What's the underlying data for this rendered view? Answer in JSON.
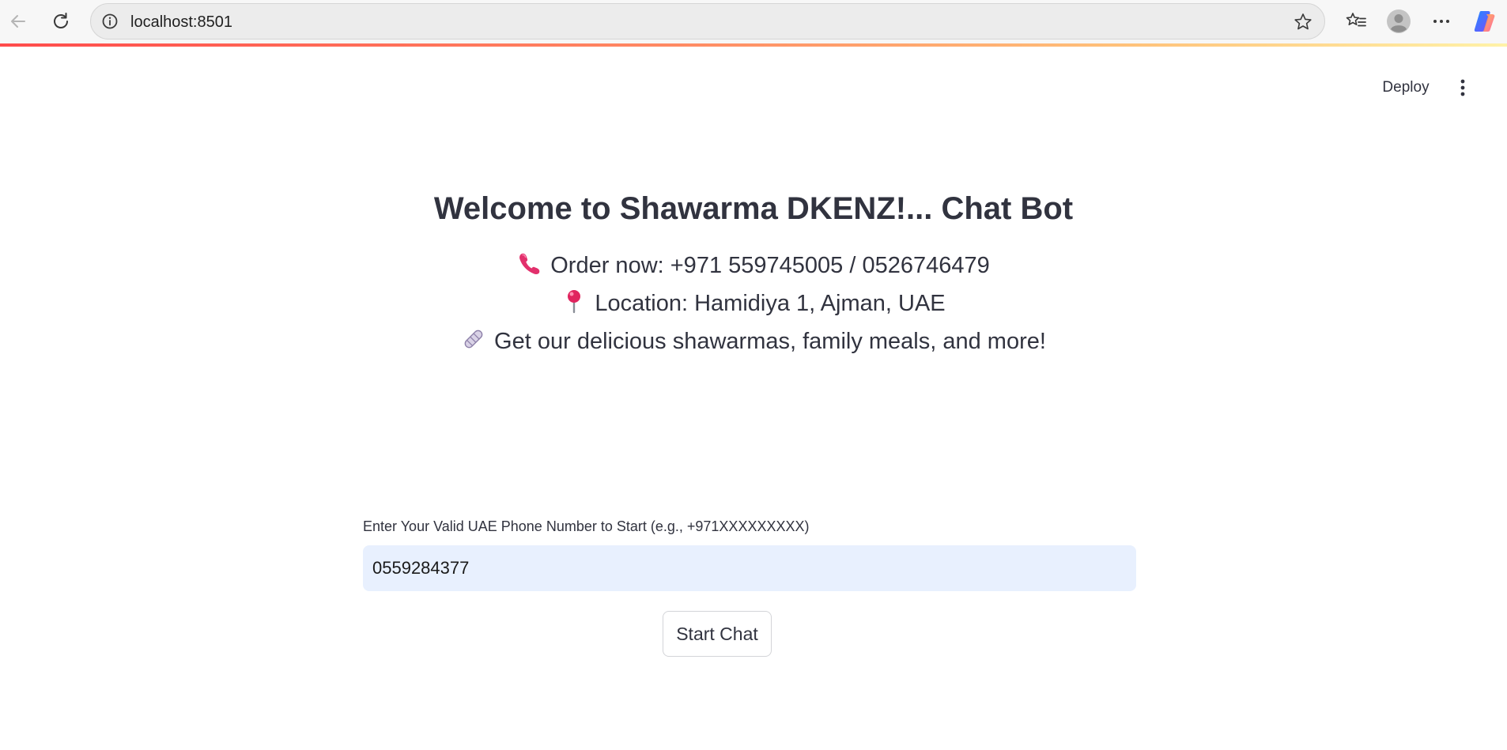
{
  "browser": {
    "url": "localhost:8501",
    "icons": [
      "back-icon",
      "reload-icon",
      "site-info-icon",
      "favorite-star-icon",
      "favorites-list-icon",
      "profile-avatar-icon",
      "more-options-icon",
      "copilot-icon"
    ]
  },
  "header": {
    "deploy_label": "Deploy",
    "menu_icon": "kebab-menu-icon"
  },
  "welcome": {
    "title": "Welcome to Shawarma DKENZ!... Chat Bot",
    "lines": [
      {
        "icon": "telephone-icon",
        "text": "Order now: +971 559745005 / 0526746479"
      },
      {
        "icon": "pushpin-icon",
        "text": "Location: Hamidiya 1, Ajman, UAE"
      },
      {
        "icon": "wrap-icon",
        "text": "Get our delicious shawarmas, family meals, and more!"
      }
    ]
  },
  "form": {
    "label": "Enter Your Valid UAE Phone Number to Start (e.g., +971XXXXXXXXX)",
    "phone_value": "0559284377",
    "submit_label": "Start Chat"
  },
  "colors": {
    "text": "#31333f",
    "input_bg": "#e8f0fe",
    "accent": "#ff4b4b"
  }
}
